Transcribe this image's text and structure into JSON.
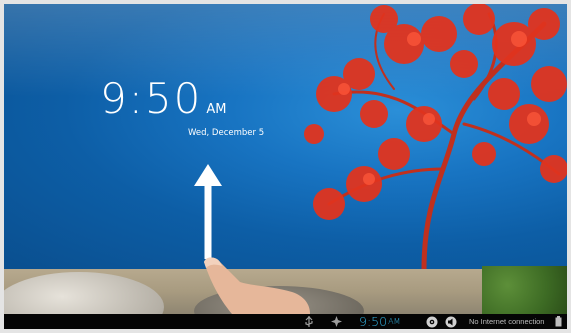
{
  "lockscreen": {
    "clock_time": "9:50",
    "clock_ampm": "AM",
    "date": "Wed, December 5"
  },
  "statusbar": {
    "time": "9:50",
    "ampm": "AM",
    "connection_text": "No Internet connection",
    "time_color": "#33b5e5",
    "icons": [
      "usb-icon",
      "android-debug-icon",
      "settings-icon",
      "volume-icon",
      "battery-icon"
    ]
  }
}
